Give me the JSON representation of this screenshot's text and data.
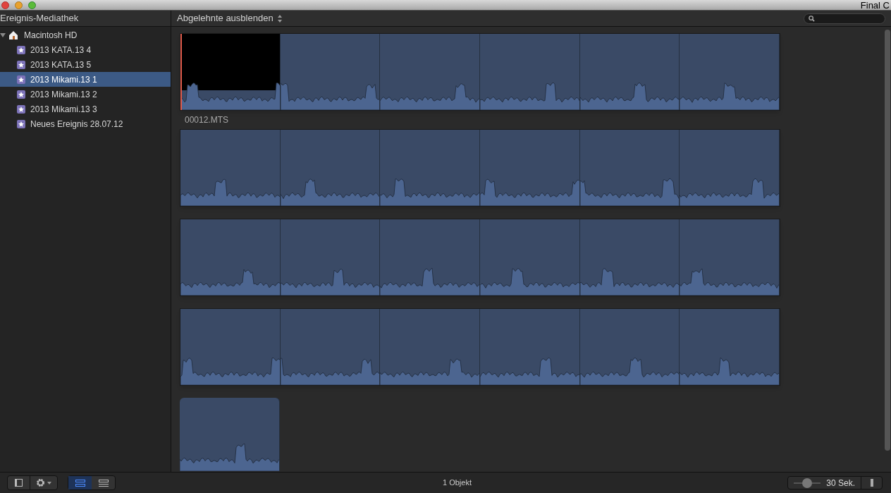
{
  "window": {
    "title": "Final C"
  },
  "library": {
    "title": "Ereignis-Mediathek",
    "tree": [
      {
        "label": "Macintosh HD",
        "expanded": true,
        "children": [
          {
            "label": "2013 KATA.13 4",
            "selected": false
          },
          {
            "label": "2013 KATA.13 5",
            "selected": false
          },
          {
            "label": "2013 Mikami.13 1",
            "selected": true
          },
          {
            "label": "2013 Mikami.13 2",
            "selected": false
          },
          {
            "label": "2013 Mikami.13 3",
            "selected": false
          },
          {
            "label": "Neues Ereignis 28.07.12",
            "selected": false
          }
        ]
      }
    ]
  },
  "browser": {
    "filter": "Abgelehnte ausblenden",
    "strips": [
      {
        "kind": "full",
        "playhead": true,
        "caption": "00012.MTS"
      },
      {
        "kind": "full",
        "playhead": false
      },
      {
        "kind": "full",
        "playhead": false
      },
      {
        "kind": "full",
        "playhead": false
      },
      {
        "kind": "partial",
        "playhead": false
      }
    ]
  },
  "status_bar": {
    "view_buttons": [
      {
        "kind": "filmstrip",
        "selected": true
      },
      {
        "kind": "list",
        "selected": false
      }
    ],
    "count": "1 Objekt",
    "zoom": {
      "level": 0.5,
      "reading": "30 Sek."
    }
  }
}
